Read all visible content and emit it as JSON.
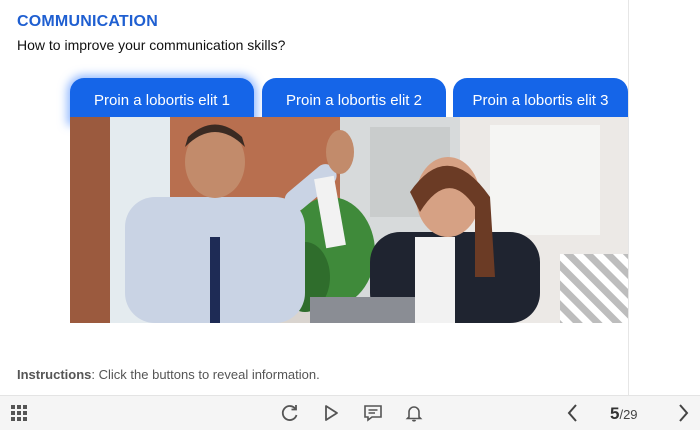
{
  "slide": {
    "title": "COMMUNICATION",
    "subtitle": "How to improve your communication skills?"
  },
  "tabs": [
    {
      "label": "Proin a lobortis elit 1",
      "active": true
    },
    {
      "label": "Proin a lobortis elit 2",
      "active": false
    },
    {
      "label": "Proin a lobortis elit 3",
      "active": false
    }
  ],
  "instructions": {
    "label": "Instructions",
    "text": ": Click the buttons to reveal information."
  },
  "toolbar": {
    "icons": [
      "menu-grid-icon",
      "replay-icon",
      "play-icon",
      "captions-icon",
      "notification-bell-icon",
      "previous-icon",
      "next-icon"
    ],
    "page_current": "5",
    "page_total": "/29"
  },
  "colors": {
    "accent": "#1565e8",
    "title": "#1f5fd1",
    "toolbar_bg": "#f5f5f5"
  }
}
